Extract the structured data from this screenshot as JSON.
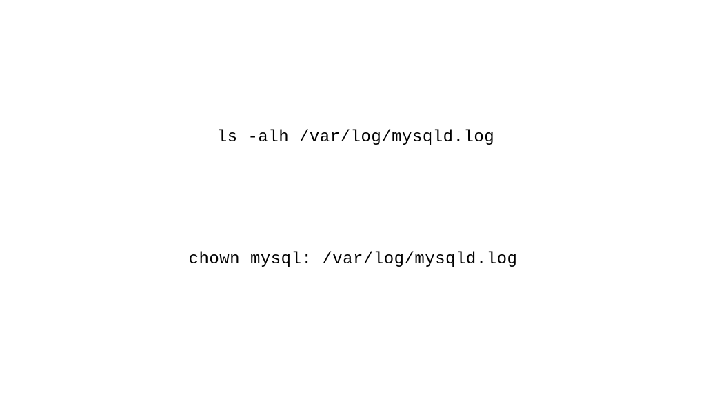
{
  "commands": {
    "line1": "ls -alh /var/log/mysqld.log",
    "line2": "chown mysql: /var/log/mysqld.log"
  }
}
